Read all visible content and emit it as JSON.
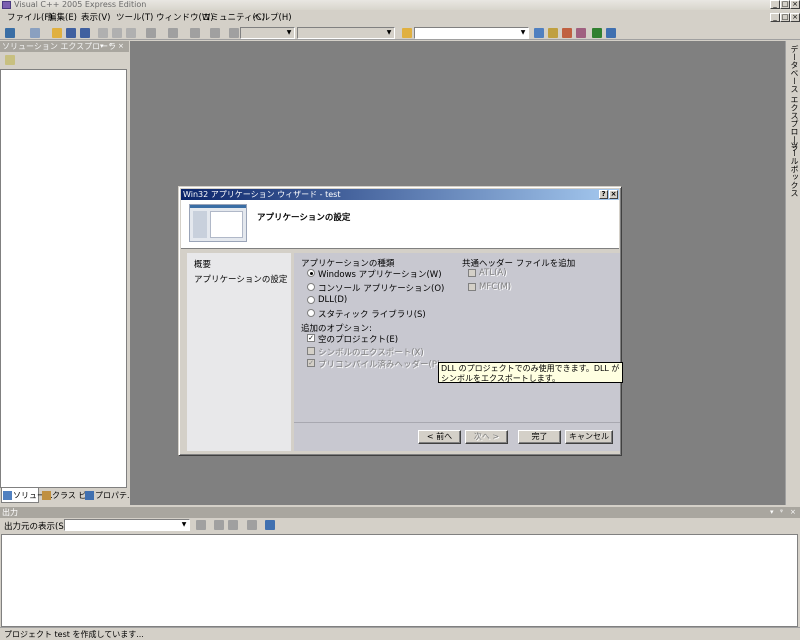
{
  "window": {
    "title": "Visual C++ 2005 Express Edition"
  },
  "menu": [
    "ファイル(F)",
    "編集(E)",
    "表示(V)",
    "ツール(T)",
    "ウィンドウ(W)",
    "コミュニティ(C)",
    "ヘルプ(H)"
  ],
  "solution_explorer": {
    "title": "ソリューション エクスプローラ",
    "tabs": [
      "ソリュー...",
      "クラス ビ...",
      "プロパテ..."
    ]
  },
  "right_dock": {
    "tabs": [
      "データベース エクスプローラ",
      "ツールボックス"
    ]
  },
  "dialog": {
    "title": "Win32 アプリケーション ウィザード - test",
    "heading": "アプリケーションの設定",
    "nav": [
      "概要",
      "アプリケーションの設定"
    ],
    "app_type_label": "アプリケーションの種類",
    "app_types": [
      "Windows アプリケーション(W)",
      "コンソール アプリケーション(O)",
      "DLL(D)",
      "スタティック ライブラリ(S)"
    ],
    "selected_app_type": "Windows アプリケーション(W)",
    "options_label": "追加のオプション:",
    "options": [
      {
        "label": "空のプロジェクト(E)",
        "checked": true,
        "enabled": true
      },
      {
        "label": "シンボルのエクスポート(X)",
        "checked": false,
        "enabled": false
      },
      {
        "label": "プリコンパイル済みヘッダー(P)",
        "checked": true,
        "enabled": false
      }
    ],
    "headers_label": "共通ヘッダー ファイルを追加",
    "headers": [
      {
        "label": "ATL(A)",
        "checked": false,
        "enabled": false
      },
      {
        "label": "MFC(M)",
        "checked": false,
        "enabled": false
      }
    ],
    "tooltip": "DLL のプロジェクトでのみ使用できます。DLL がシンボルをエクスポートします。",
    "buttons": {
      "back": "< 前へ",
      "next": "次へ >",
      "finish": "完了",
      "cancel": "キャンセル"
    }
  },
  "output": {
    "title": "出力",
    "source_label": "出力元の表示(S):",
    "source_value": ""
  },
  "status": {
    "text": "プロジェクト test を作成しています..."
  }
}
